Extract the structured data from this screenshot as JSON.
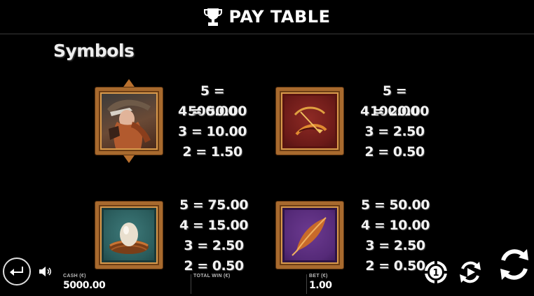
{
  "header": {
    "title": "PAY TABLE",
    "icon": "trophy-icon"
  },
  "section": {
    "title": "Symbols"
  },
  "symbols": [
    {
      "name": "warrior-woman",
      "pays": [
        "5 = 500.00",
        "4 = 50.00",
        "3 = 10.00",
        "2 = 1.50"
      ]
    },
    {
      "name": "bow-and-arrow",
      "pays": [
        "5 = 100.00",
        "4 = 20.00",
        "3 = 2.50",
        "2 = 0.50"
      ]
    },
    {
      "name": "egg-in-nest",
      "pays": [
        "5 = 75.00",
        "4 = 15.00",
        "3 = 2.50",
        "2 = 0.50"
      ]
    },
    {
      "name": "feather",
      "pays": [
        "5 = 50.00",
        "4 = 10.00",
        "3 = 2.50",
        "2 = 0.50"
      ]
    }
  ],
  "bottom_bar": {
    "cash_label": "CASH (€)",
    "cash_value": "5000.00",
    "total_win_label": "TOTAL WIN (€)",
    "total_win_value": "",
    "bet_label": "BET (€)",
    "bet_value": "1.00"
  },
  "colors": {
    "frame": "#a86a2e",
    "warrior_bg": "#5b3a2a",
    "bow_bg": "#7a1e1c",
    "egg_bg": "#2f6b6b",
    "feather_bg": "#5a2a7a"
  }
}
